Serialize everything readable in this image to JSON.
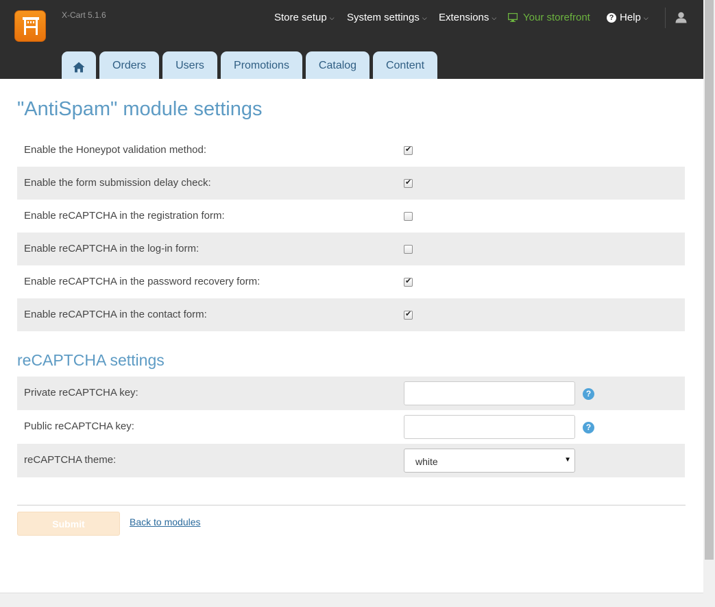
{
  "app": {
    "version": "X-Cart 5.1.6"
  },
  "topnav": {
    "store_setup": "Store setup",
    "system_settings": "System settings",
    "extensions": "Extensions",
    "storefront": "Your storefront",
    "help": "Help",
    "caret": "⌵"
  },
  "tabs": [
    {
      "label": "Home",
      "icon": "home-icon"
    },
    {
      "label": "Orders"
    },
    {
      "label": "Users"
    },
    {
      "label": "Promotions"
    },
    {
      "label": "Catalog"
    },
    {
      "label": "Content"
    }
  ],
  "page": {
    "title": "\"AntiSpam\" module settings"
  },
  "settings": [
    {
      "label": "Enable the Honeypot validation method:",
      "checked": true
    },
    {
      "label": "Enable the form submission delay check:",
      "checked": true
    },
    {
      "label": "Enable reCAPTCHA in the registration form:",
      "checked": false
    },
    {
      "label": "Enable reCAPTCHA in the log-in form:",
      "checked": false
    },
    {
      "label": "Enable reCAPTCHA in the password recovery form:",
      "checked": true
    },
    {
      "label": "Enable reCAPTCHA in the contact form:",
      "checked": true
    }
  ],
  "recaptcha": {
    "section_title": "reCAPTCHA settings",
    "private_key_label": "Private reCAPTCHA key:",
    "private_key_value": "",
    "public_key_label": "Public reCAPTCHA key:",
    "public_key_value": "",
    "theme_label": "reCAPTCHA theme:",
    "theme_value": "white",
    "help_glyph": "?"
  },
  "actions": {
    "submit": "Submit",
    "back": "Back to modules"
  },
  "colors": {
    "header_bg": "#2e2e2e",
    "tab_bg": "#d3e7f5",
    "accent": "#5d9bc4",
    "storefront": "#6cb33f",
    "logo": "#f7941d"
  }
}
